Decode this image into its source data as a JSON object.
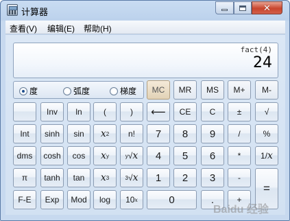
{
  "window": {
    "title": "计算器"
  },
  "menu": {
    "view": "查看(V)",
    "edit": "编辑(E)",
    "help": "帮助(H)"
  },
  "display": {
    "expression": "fact(4)",
    "value": "24"
  },
  "angle": {
    "degree": "度",
    "radian": "弧度",
    "gradian": "梯度",
    "selected": "degree"
  },
  "keys": {
    "mc": "MC",
    "mr": "MR",
    "ms": "MS",
    "mplus": "M+",
    "mminus": "M-",
    "inv": "Inv",
    "ln": "ln",
    "lparen": "(",
    "rparen": ")",
    "backspace": "⟵",
    "ce": "CE",
    "c": "C",
    "plusminus": "±",
    "sqrt": "√",
    "int": "Int",
    "sinh": "sinh",
    "sin": "sin",
    "x2_base": "x",
    "x2_exp": "2",
    "fact": "n!",
    "seven": "7",
    "eight": "8",
    "nine": "9",
    "divide": "/",
    "percent": "%",
    "dms": "dms",
    "cosh": "cosh",
    "cos": "cos",
    "xy_base": "x",
    "xy_exp": "y",
    "yroot_index": "y",
    "yroot_sym": "√",
    "yroot_x": "x",
    "four": "4",
    "five": "5",
    "six": "6",
    "multiply": "*",
    "recip_num": "1/",
    "recip_x": "x",
    "pi": "π",
    "tanh": "tanh",
    "tan": "tan",
    "x3_base": "x",
    "x3_exp": "3",
    "cuberoot_index": "3",
    "cuberoot_sym": "√",
    "cuberoot_x": "x",
    "one": "1",
    "two": "2",
    "three": "3",
    "minus": "-",
    "equals": "=",
    "fe": "F-E",
    "exp": "Exp",
    "mod": "Mod",
    "log": "log",
    "tenx_base": "10",
    "tenx_exp": "x",
    "zero": "0",
    "dot": ".",
    "plus": "+"
  },
  "watermark": "Baidu 经验"
}
